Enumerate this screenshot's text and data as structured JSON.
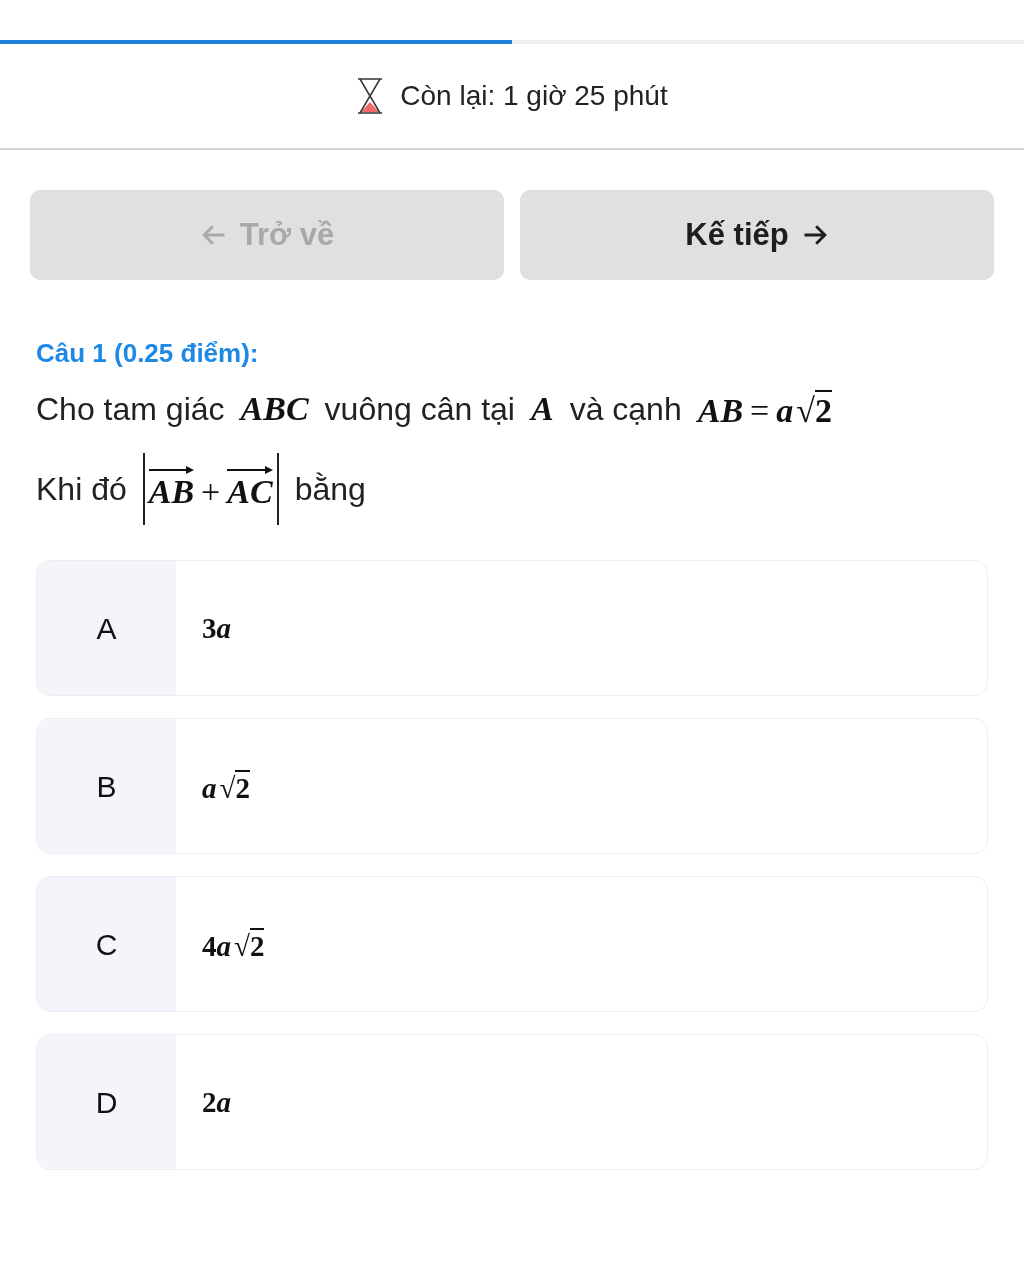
{
  "progress": {
    "level": 0.5
  },
  "timer": {
    "text": "Còn lại: 1 giờ 25 phút"
  },
  "nav_buttons": [
    {
      "kind": "back",
      "label": "Trở về",
      "disabled": true
    },
    {
      "kind": "next",
      "label": "Kế tiếp",
      "disabled": false
    }
  ],
  "question": {
    "title": "Câu 1 (0.25 điểm):",
    "lines": [
      [
        {
          "kind": "text",
          "text": "Cho tam giác"
        },
        {
          "kind": "math",
          "parts": [
            {
              "kind": "var",
              "text": "ABC"
            }
          ]
        },
        {
          "kind": "text",
          "text": "vuông cân tại"
        },
        {
          "kind": "math",
          "parts": [
            {
              "kind": "var",
              "text": "A"
            }
          ]
        },
        {
          "kind": "text",
          "text": "và cạnh"
        },
        {
          "kind": "math",
          "parts": [
            {
              "kind": "var",
              "text": "AB"
            },
            {
              "kind": "op",
              "text": "="
            },
            {
              "kind": "var",
              "text": "a"
            },
            {
              "kind": "radical",
              "text": "√"
            },
            {
              "kind": "radicand",
              "text": "2"
            }
          ]
        }
      ],
      [
        {
          "kind": "text",
          "text": "Khi đó"
        },
        {
          "kind": "abs",
          "parts": [
            {
              "kind": "vector",
              "text": "AB"
            },
            {
              "kind": "op",
              "text": "+"
            },
            {
              "kind": "vector",
              "text": "AC"
            }
          ]
        },
        {
          "kind": "text",
          "text": "bằng"
        }
      ]
    ]
  },
  "options": [
    {
      "letter": "A",
      "selected": false,
      "answer": [
        {
          "kind": "num",
          "text": "3"
        },
        {
          "kind": "var",
          "text": "a"
        }
      ]
    },
    {
      "letter": "B",
      "selected": false,
      "answer": [
        {
          "kind": "var",
          "text": "a"
        },
        {
          "kind": "radical",
          "text": "√"
        },
        {
          "kind": "radicand",
          "text": "2"
        }
      ]
    },
    {
      "letter": "C",
      "selected": false,
      "answer": [
        {
          "kind": "num",
          "text": "4"
        },
        {
          "kind": "var",
          "text": "a"
        },
        {
          "kind": "radical",
          "text": "√"
        },
        {
          "kind": "radicand",
          "text": "2"
        }
      ]
    },
    {
      "letter": "D",
      "selected": false,
      "answer": [
        {
          "kind": "num",
          "text": "2"
        },
        {
          "kind": "var",
          "text": "a"
        }
      ]
    }
  ]
}
